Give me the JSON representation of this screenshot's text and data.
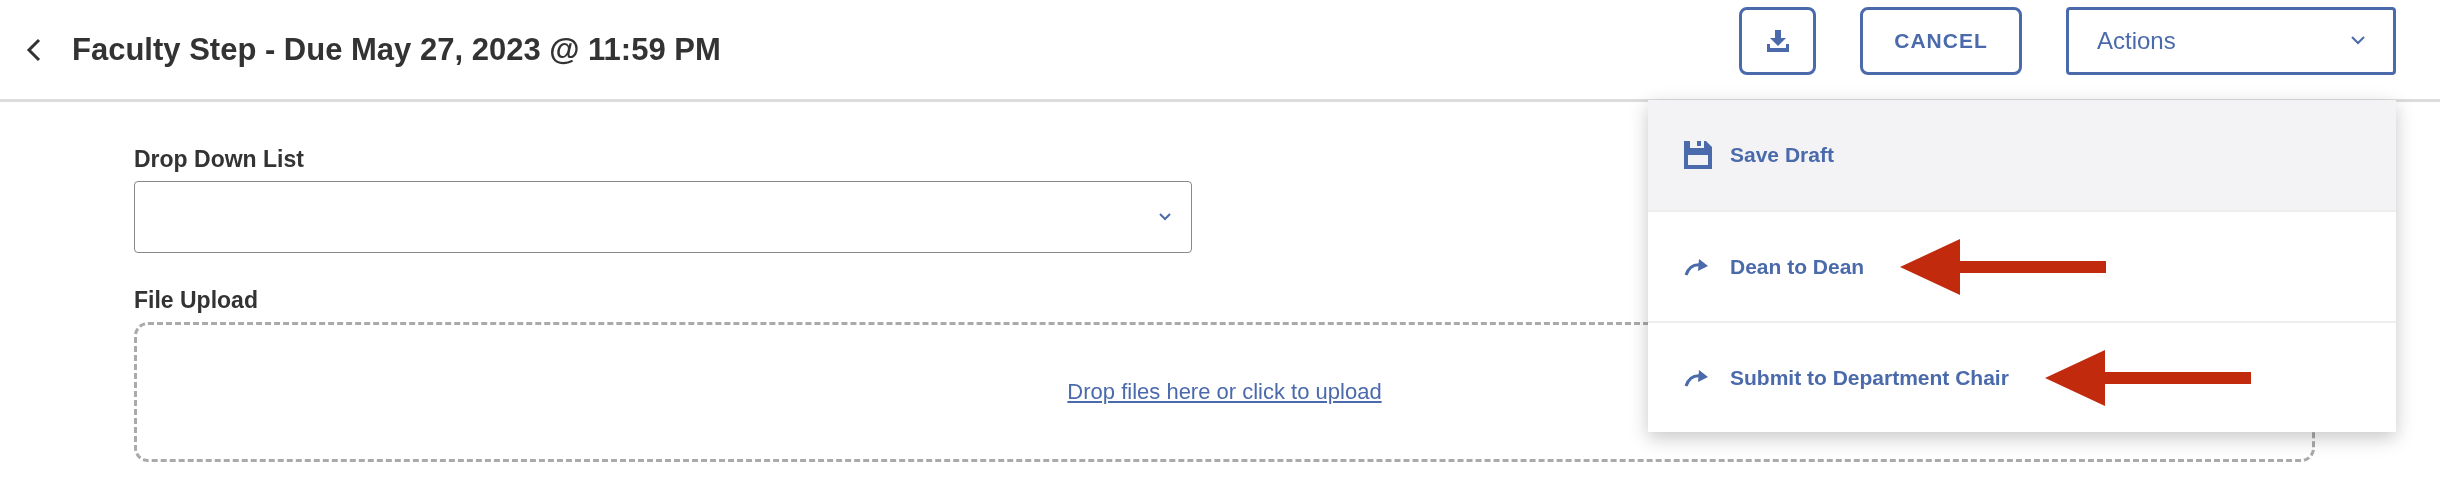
{
  "header": {
    "title": "Faculty Step - Due May 27, 2023 @ 11:59 PM",
    "buttons": [
      {
        "kind": "download"
      },
      {
        "kind": "text",
        "label": "CANCEL"
      }
    ],
    "actions": {
      "label": "Actions",
      "expanded": true
    }
  },
  "actions_menu": [
    {
      "kind": "save",
      "label": "Save Draft",
      "highlighted": true,
      "annotation_arrow": false
    },
    {
      "kind": "forward",
      "label": "Dean to Dean",
      "highlighted": false,
      "annotation_arrow": true
    },
    {
      "kind": "forward",
      "label": "Submit to Department Chair",
      "highlighted": false,
      "annotation_arrow": true
    }
  ],
  "form": {
    "fields": [
      {
        "kind": "select",
        "label": "Drop Down List"
      },
      {
        "kind": "upload",
        "label": "File Upload",
        "link": "Drop files here or click to upload"
      }
    ]
  }
}
